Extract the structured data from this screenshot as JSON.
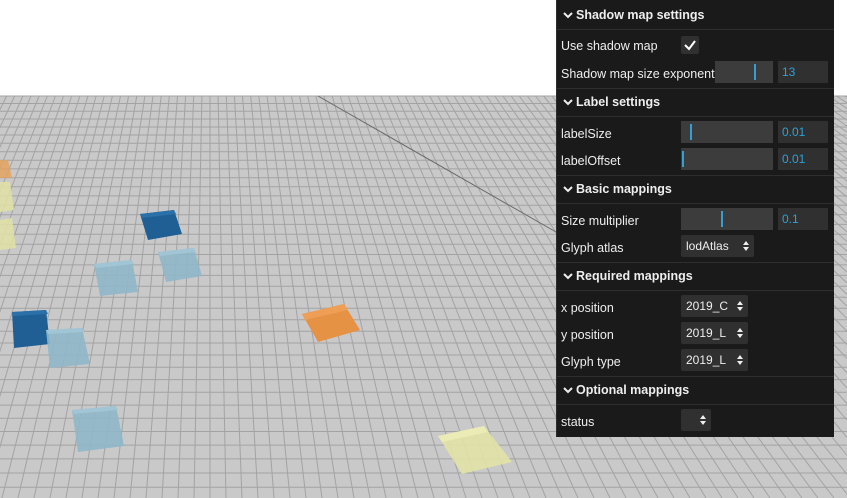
{
  "sections": {
    "shadow": {
      "title": "Shadow map settings"
    },
    "label": {
      "title": "Label settings"
    },
    "basic": {
      "title": "Basic mappings"
    },
    "required": {
      "title": "Required mappings"
    },
    "optional": {
      "title": "Optional mappings"
    }
  },
  "controls": {
    "use_shadow_map": {
      "label": "Use shadow map",
      "checked": true
    },
    "shadow_map_size_exponent": {
      "label": "Shadow map size exponent",
      "value": "13",
      "level": 0.7
    },
    "label_size": {
      "label": "labelSize",
      "value": "0.01",
      "level": 0.1
    },
    "label_offset": {
      "label": "labelOffset",
      "value": "0.01",
      "level": 0.01
    },
    "size_multiplier": {
      "label": "Size multiplier",
      "value": "0.1",
      "level": 0.45
    },
    "glyph_atlas": {
      "label": "Glyph atlas",
      "value": "lodAtlas"
    },
    "x_position": {
      "label": "x position",
      "value": "2019_C"
    },
    "y_position": {
      "label": "y position",
      "value": "2019_L"
    },
    "glyph_type": {
      "label": "Glyph type",
      "value": "2019_L"
    },
    "status": {
      "label": "status",
      "value": ""
    }
  },
  "colors": {
    "panel_bg": "#1a1a1a",
    "accent": "#2fa1d6",
    "grid_line": "#9a9a9a",
    "ground": "#c9c9c9",
    "glyph_dark_blue": "#1f5f94",
    "glyph_light_blue": "#8fb7c9",
    "glyph_orange": "#e59245",
    "glyph_yellow": "#e2e2a6"
  },
  "icons": {
    "chevron": "chevron-down-icon",
    "check": "checkmark-icon",
    "select_arrows": "up-down-arrows-icon"
  }
}
